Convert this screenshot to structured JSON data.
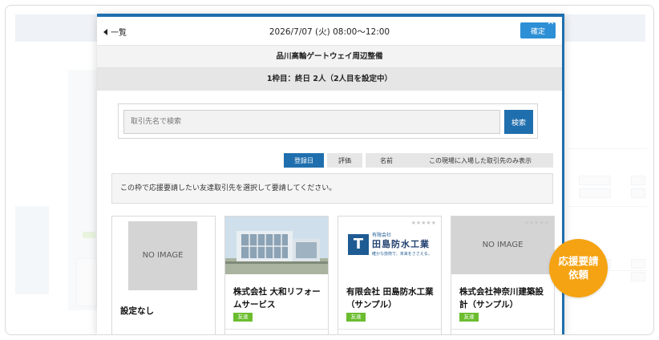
{
  "header": {
    "back_label": "一覧",
    "datetime": "2026/7/07 (火) 08:00〜12:00",
    "confirm_label": "確定"
  },
  "site_name": "品川高輪ゲートウェイ周辺整備",
  "slot_info": "1枠目：終日 2人（2人目を設定中）",
  "search": {
    "placeholder": "取引先名で検索",
    "button_label": "検索"
  },
  "sort_tabs": [
    {
      "label": "登録日",
      "active": true
    },
    {
      "label": "評価",
      "active": false
    },
    {
      "label": "名前",
      "active": false
    },
    {
      "label": "この現場に入場した取引先のみ表示",
      "active": false
    }
  ],
  "instruction": "この枠で応援要請したい友達取引先を選択して要請してください。",
  "cards": [
    {
      "name": "設定なし",
      "image": "NO IMAGE",
      "badge": ""
    },
    {
      "name": "株式会社 大和リフォームサービス",
      "image": "building-photo",
      "badge": "友達"
    },
    {
      "name": "有限会社 田島防水工業（サンプル）",
      "image": "logo",
      "logo_small": "有限会社",
      "logo_text": "田島防水工業",
      "logo_sub": "確かな技術で、未来をささえる。",
      "badge": "友達"
    },
    {
      "name": "株式会社神奈川建築設計（サンプル）",
      "image": "NO IMAGE",
      "badge": "友達"
    }
  ],
  "fab_label_line1": "応援要請",
  "fab_label_line2": "依頼",
  "colors": {
    "primary": "#1f6fae",
    "accent_orange": "#f5a312",
    "badge_green": "#6bbd2f"
  }
}
